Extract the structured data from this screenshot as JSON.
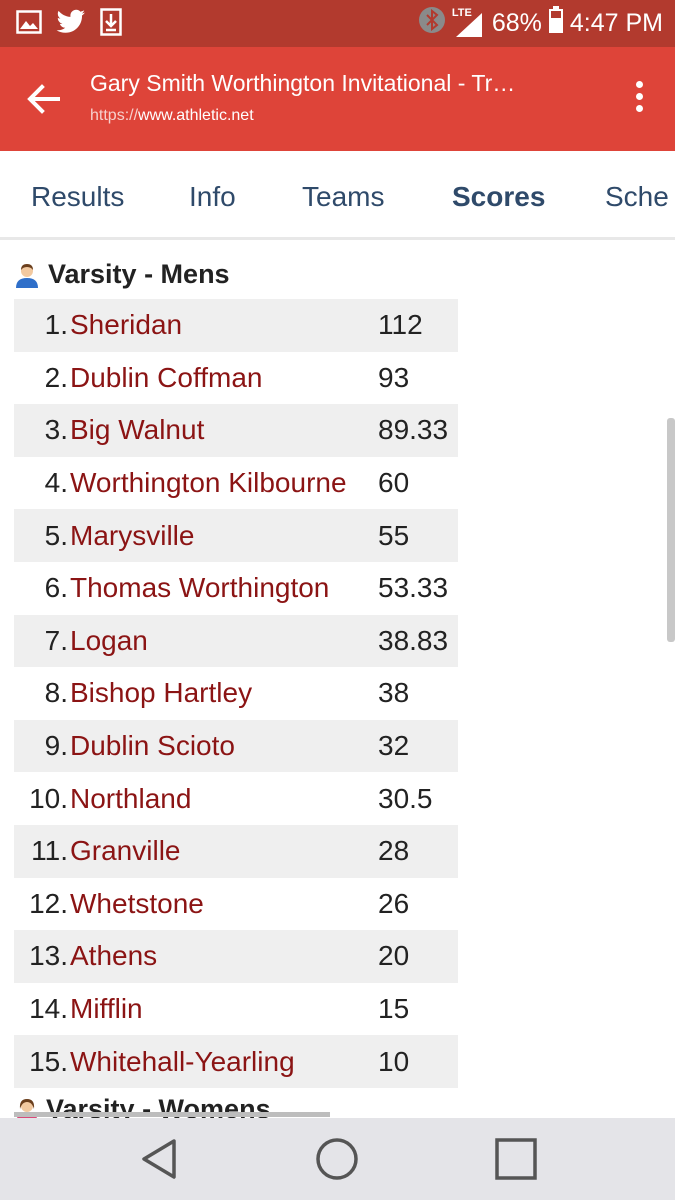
{
  "status_bar": {
    "network": "LTE",
    "battery": "68%",
    "time": "4:47 PM"
  },
  "app_bar": {
    "title": "Gary Smith Worthington Invitational - Tr…",
    "url_protocol": "https://",
    "url_host": "www.athletic.net",
    "color": "#de4439"
  },
  "tabs": [
    {
      "label": "Results"
    },
    {
      "label": "Info"
    },
    {
      "label": "Teams"
    },
    {
      "label": "Scores"
    },
    {
      "label": "Sche"
    }
  ],
  "active_tab": "Scores",
  "section": {
    "title": "Varsity - Mens",
    "icon": "male-person-icon"
  },
  "standings": [
    {
      "rank": "1.",
      "team": "Sheridan",
      "score": "112"
    },
    {
      "rank": "2.",
      "team": "Dublin Coffman",
      "score": "93"
    },
    {
      "rank": "3.",
      "team": "Big Walnut",
      "score": "89.33"
    },
    {
      "rank": "4.",
      "team": "Worthington Kilbourne",
      "score": "60"
    },
    {
      "rank": "5.",
      "team": "Marysville",
      "score": "55"
    },
    {
      "rank": "6.",
      "team": "Thomas Worthington",
      "score": "53.33"
    },
    {
      "rank": "7.",
      "team": "Logan",
      "score": "38.83"
    },
    {
      "rank": "8.",
      "team": "Bishop Hartley",
      "score": "38"
    },
    {
      "rank": "9.",
      "team": "Dublin Scioto",
      "score": "32"
    },
    {
      "rank": "10.",
      "team": "Northland",
      "score": "30.5"
    },
    {
      "rank": "11.",
      "team": "Granville",
      "score": "28"
    },
    {
      "rank": "12.",
      "team": "Whetstone",
      "score": "26"
    },
    {
      "rank": "13.",
      "team": "Athens",
      "score": "20"
    },
    {
      "rank": "14.",
      "team": "Mifflin",
      "score": "15"
    },
    {
      "rank": "15.",
      "team": "Whitehall-Yearling",
      "score": "10"
    }
  ],
  "section2": {
    "title": "Varsity - Womens",
    "icon": "female-person-icon"
  },
  "colors": {
    "team_link": "#8b1414",
    "tab_text": "#2f4a6a",
    "status_bar": "#b23a2e"
  }
}
